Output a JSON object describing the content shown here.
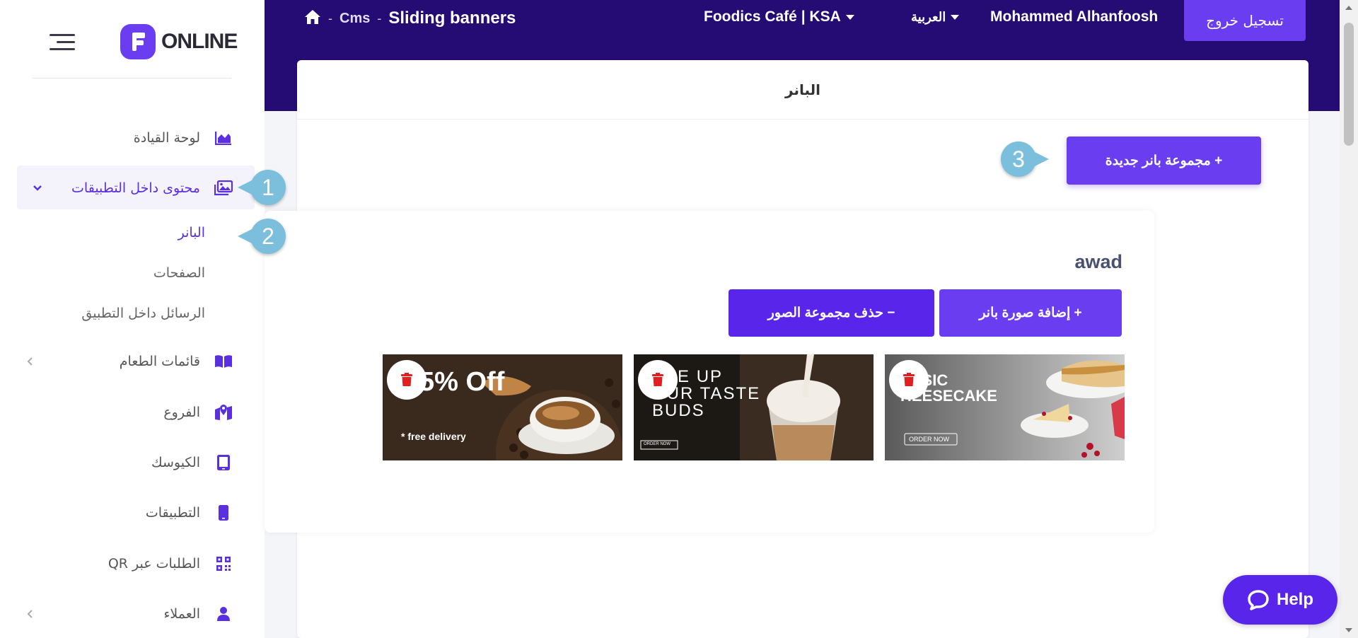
{
  "brand": {
    "logo_letter": "f",
    "logo_text": "ONLINE",
    "accent": "#6a3df0",
    "topbar_color": "#250c74"
  },
  "breadcrumb": {
    "home_icon": "home-icon",
    "sep": "-",
    "section": "Cms",
    "current": "Sliding banners"
  },
  "topbar": {
    "branch": "Foodics Café | KSA",
    "language": "العربية",
    "user": "Mohammed Alhanfoosh",
    "logout": "تسجيل خروج"
  },
  "sidebar": {
    "items": [
      {
        "label": "لوحة القيادة",
        "icon": "chart-area-icon"
      },
      {
        "label": "محتوى داخل التطبيقات",
        "icon": "images-icon",
        "expanded": true
      },
      {
        "label": "قائمات الطعام",
        "icon": "book-open-icon"
      },
      {
        "label": "الفروع",
        "icon": "map-location-icon"
      },
      {
        "label": "الكيوسك",
        "icon": "tablet-icon"
      },
      {
        "label": "التطبيقات",
        "icon": "mobile-icon"
      },
      {
        "label": "الطلبات عبر QR",
        "icon": "qrcode-icon"
      },
      {
        "label": "العملاء",
        "icon": "user-icon"
      }
    ],
    "subitems": [
      "البانر",
      "الصفحات",
      "الرسائل داخل التطبيق"
    ]
  },
  "callouts": [
    "1",
    "2",
    "3"
  ],
  "page": {
    "title": "البانر",
    "new_group_btn": "+ مجموعة بانر جديدة"
  },
  "group": {
    "name": "awad",
    "add_btn": "+ إضافة صورة بانر",
    "delete_btn": "− حذف مجموعة الصور",
    "banners": [
      {
        "headline": "5% Off",
        "sub": "* free delivery"
      },
      {
        "headline": "AKE UP\nOUR TASTE\nBUDS",
        "cta": "ORDER NOW"
      },
      {
        "headline": "ASSIC\nHEESECAKE",
        "cta": "ORDER NOW"
      }
    ]
  },
  "help": {
    "label": "Help"
  }
}
